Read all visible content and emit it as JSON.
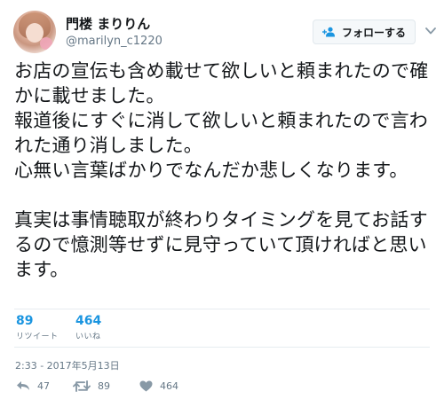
{
  "user": {
    "display_name": "門楼 まりりん",
    "screen_name": "@marilyn_c1220"
  },
  "follow_button": {
    "label": "フォローする",
    "icon": "add-user-icon"
  },
  "tweet": {
    "text": "お店の宣伝も含め載せて欲しいと頼まれたので確かに載せました。\n報道後にすぐに消して欲しいと頼まれたので言われた通り消しました。\n心無い言葉ばかりでなんだか悲しくなります。\n\n真実は事情聴取が終わりタイミングを見てお話するので憶測等せずに見守っていて頂ければと思います。",
    "timestamp": "2:33 - 2017年5月13日"
  },
  "stats": {
    "retweets": {
      "count": "89",
      "label": "リツイート"
    },
    "likes": {
      "count": "464",
      "label": "いいね"
    }
  },
  "actions": {
    "reply": {
      "icon": "reply-icon",
      "count": "47"
    },
    "retweet": {
      "icon": "retweet-icon",
      "count": "89"
    },
    "like": {
      "icon": "heart-icon",
      "count": "464"
    }
  },
  "colors": {
    "accent": "#1b95e0",
    "muted": "#657786",
    "text": "#14171a",
    "border": "#e6ecf0"
  }
}
